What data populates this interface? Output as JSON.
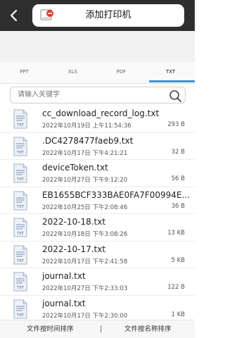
{
  "header": {
    "title": "添加打印机"
  },
  "tabs": [
    {
      "label": "PPT",
      "active": false
    },
    {
      "label": "XLS",
      "active": false
    },
    {
      "label": "PDF",
      "active": false
    },
    {
      "label": "TXT",
      "active": true
    }
  ],
  "search": {
    "placeholder": "请输入关键字",
    "value": ""
  },
  "files": [
    {
      "name": "cc_download_record_log.txt",
      "date": "2022年10月19日 上午11:54:36",
      "size": "293 B",
      "type": "TXT"
    },
    {
      "name": ".DC4278477faeb9.txt",
      "date": "2022年10月17日 下午4:21:21",
      "size": "32 B",
      "type": "TXT"
    },
    {
      "name": "deviceToken.txt",
      "date": "2022年10月27日 下午9:12:20",
      "size": "56 B",
      "type": "TXT"
    },
    {
      "name": "EB1655BCF333BAE0FA7F00994E...",
      "date": "2022年10月25日 下午2:08:46",
      "size": "36 B",
      "type": "TXT"
    },
    {
      "name": "2022-10-18.txt",
      "date": "2022年10月18日 下午3:08:26",
      "size": "13 KB",
      "type": "TXT"
    },
    {
      "name": "2022-10-17.txt",
      "date": "2022年10月17日 下午2:41:58",
      "size": "5 KB",
      "type": "TXT"
    },
    {
      "name": "journal.txt",
      "date": "2022年10月27日 下午2:33:03",
      "size": "122 B",
      "type": "TXT"
    },
    {
      "name": "journal.txt",
      "date": "2022年10月17日 下午2:30:00",
      "size": "1 KB",
      "type": "TXT"
    }
  ],
  "bottom": {
    "sort_by_time": "文件按时间排序",
    "divider": "|",
    "sort_by_name": "文件按名称排序"
  },
  "colors": {
    "header_bg": "#2e2e2e",
    "accent": "#3b93d6",
    "printer_badge": "#e23b2e"
  }
}
